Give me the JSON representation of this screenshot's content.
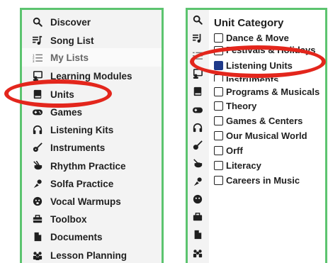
{
  "left_nav": {
    "items": [
      {
        "label": "Discover",
        "icon": "search-icon",
        "active": false
      },
      {
        "label": "Song List",
        "icon": "song-list-icon",
        "active": false
      },
      {
        "label": "My Lists",
        "icon": "list-icon",
        "active": true
      },
      {
        "label": "Learning Modules",
        "icon": "learning-modules-icon",
        "active": false
      },
      {
        "label": "Units",
        "icon": "book-icon",
        "active": false
      },
      {
        "label": "Games",
        "icon": "gamepad-icon",
        "active": false
      },
      {
        "label": "Listening Kits",
        "icon": "headphones-icon",
        "active": false
      },
      {
        "label": "Instruments",
        "icon": "guitar-icon",
        "active": false
      },
      {
        "label": "Rhythm Practice",
        "icon": "drum-icon",
        "active": false
      },
      {
        "label": "Solfa Practice",
        "icon": "hand-icon",
        "active": false
      },
      {
        "label": "Vocal Warmups",
        "icon": "face-icon",
        "active": false
      },
      {
        "label": "Toolbox",
        "icon": "toolbox-icon",
        "active": false
      },
      {
        "label": "Documents",
        "icon": "document-icon",
        "active": false
      },
      {
        "label": "Lesson Planning",
        "icon": "people-icon",
        "active": false
      }
    ]
  },
  "unit_category": {
    "title": "Unit Category",
    "options": [
      {
        "label": "Dance & Move",
        "checked": false
      },
      {
        "label": "Festivals & Holidays",
        "checked": false
      },
      {
        "label": "Listening Units",
        "checked": true
      },
      {
        "label": "Instruments",
        "checked": false
      },
      {
        "label": "Programs & Musicals",
        "checked": false
      },
      {
        "label": "Theory",
        "checked": false
      },
      {
        "label": "Games & Centers",
        "checked": false
      },
      {
        "label": "Our Musical World",
        "checked": false
      },
      {
        "label": "Orff",
        "checked": false
      },
      {
        "label": "Literacy",
        "checked": false
      },
      {
        "label": "Careers in Music",
        "checked": false
      }
    ]
  },
  "colors": {
    "panel_border": "#5cc46f",
    "annotation": "#e3261c",
    "checked": "#1f3a8a"
  }
}
